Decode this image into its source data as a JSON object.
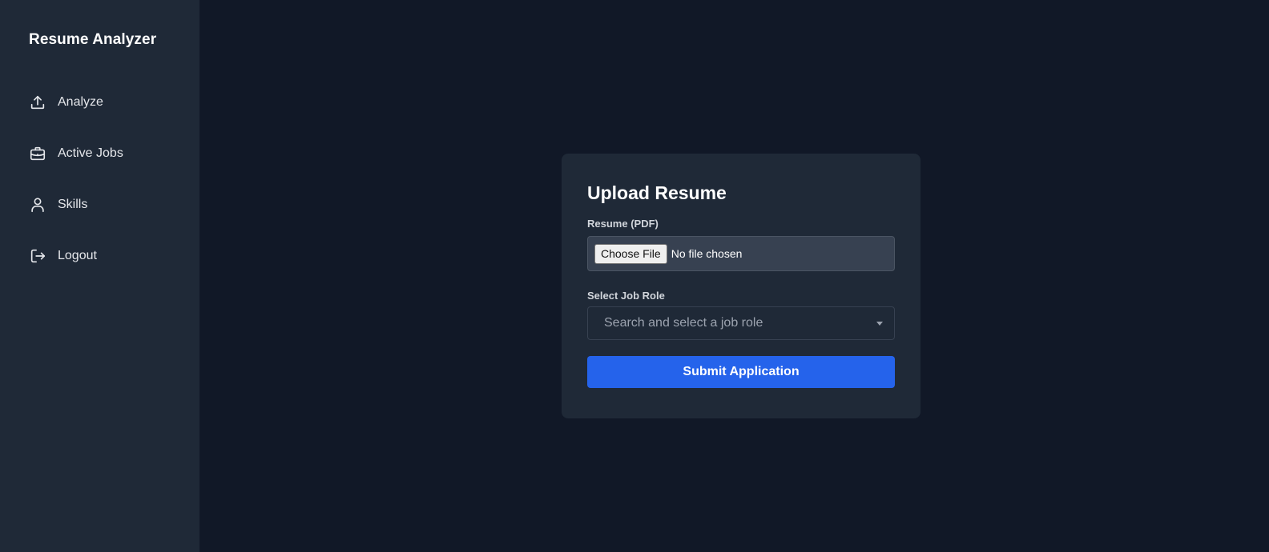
{
  "sidebar": {
    "brand": "Resume Analyzer",
    "items": [
      {
        "label": "Analyze",
        "icon": "upload-icon"
      },
      {
        "label": "Active Jobs",
        "icon": "briefcase-icon"
      },
      {
        "label": "Skills",
        "icon": "user-icon"
      },
      {
        "label": "Logout",
        "icon": "logout-icon"
      }
    ]
  },
  "card": {
    "title": "Upload Resume",
    "resume_label": "Resume (PDF)",
    "file_button": "Choose File",
    "file_status": "No file chosen",
    "job_role_label": "Select Job Role",
    "job_role_placeholder": "Search and select a job role",
    "submit_label": "Submit Application"
  },
  "colors": {
    "background": "#111827",
    "sidebar": "#1f2937",
    "card": "#1f2937",
    "accent": "#2563eb"
  }
}
